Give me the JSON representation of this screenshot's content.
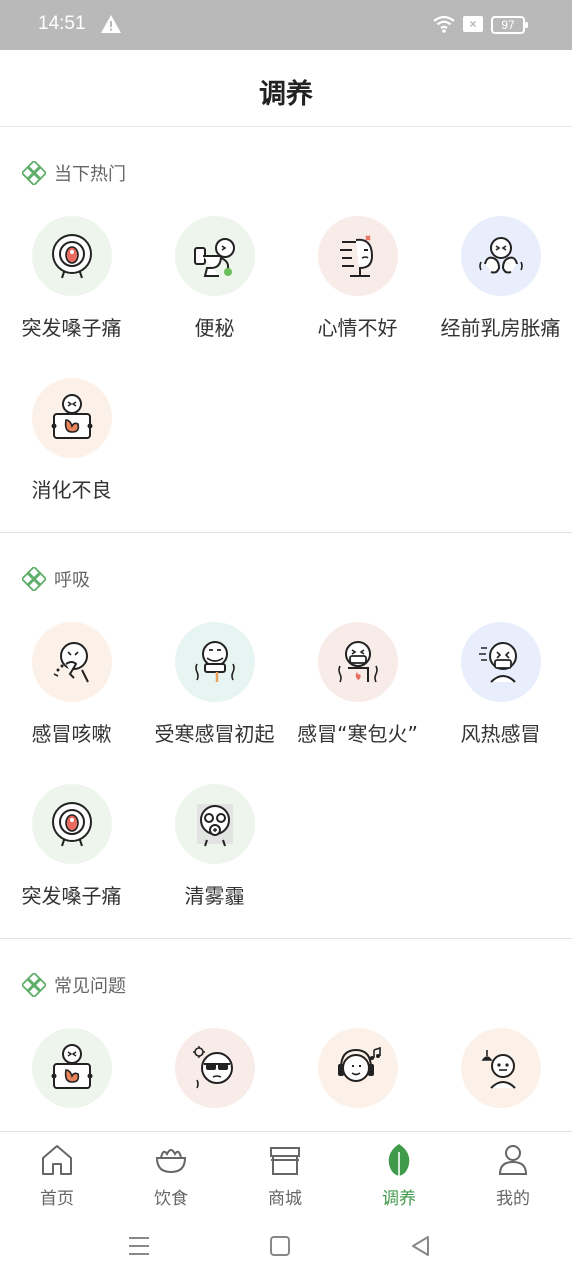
{
  "status": {
    "time": "14:51",
    "battery": "97",
    "sim": "×"
  },
  "header": {
    "title": "调养"
  },
  "sections": [
    {
      "title": "当下热门",
      "items": [
        {
          "label": "突发嗓子痛",
          "icon": "sore-throat-icon",
          "bg": "green"
        },
        {
          "label": "便秘",
          "icon": "constipation-icon",
          "bg": "green"
        },
        {
          "label": "心情不好",
          "icon": "bad-mood-icon",
          "bg": "pink"
        },
        {
          "label": "经前乳房胀痛",
          "icon": "breast-pain-icon",
          "bg": "blue"
        },
        {
          "label": "消化不良",
          "icon": "indigestion-icon",
          "bg": "orange"
        }
      ]
    },
    {
      "title": "呼吸",
      "items": [
        {
          "label": "感冒咳嗽",
          "icon": "cough-icon",
          "bg": "orange"
        },
        {
          "label": "受寒感冒初起",
          "icon": "cold-chill-icon",
          "bg": "mint"
        },
        {
          "label": "感冒“寒包火”",
          "icon": "cold-fire-icon",
          "bg": "pink"
        },
        {
          "label": "风热感冒",
          "icon": "wind-heat-icon",
          "bg": "blue"
        },
        {
          "label": "突发嗓子痛",
          "icon": "sore-throat-icon",
          "bg": "green"
        },
        {
          "label": "清雾霾",
          "icon": "gas-mask-icon",
          "bg": "green"
        }
      ]
    },
    {
      "title": "常见问题",
      "items": [
        {
          "label": "",
          "icon": "indigestion-icon",
          "bg": "green"
        },
        {
          "label": "",
          "icon": "sunglasses-icon",
          "bg": "pink"
        },
        {
          "label": "",
          "icon": "headphones-icon",
          "bg": "orange"
        },
        {
          "label": "",
          "icon": "person-lamp-icon",
          "bg": "orange"
        }
      ]
    }
  ],
  "tabs": [
    {
      "label": "首页",
      "icon": "home-icon",
      "active": false
    },
    {
      "label": "饮食",
      "icon": "food-bowl-icon",
      "active": false
    },
    {
      "label": "商城",
      "icon": "shop-icon",
      "active": false
    },
    {
      "label": "调养",
      "icon": "leaf-icon",
      "active": true
    },
    {
      "label": "我的",
      "icon": "user-icon",
      "active": false
    }
  ],
  "colors": {
    "accent": "#3f9a4a",
    "statusbar": "#b9b9b9",
    "text": "#333333",
    "muted": "#666666"
  }
}
